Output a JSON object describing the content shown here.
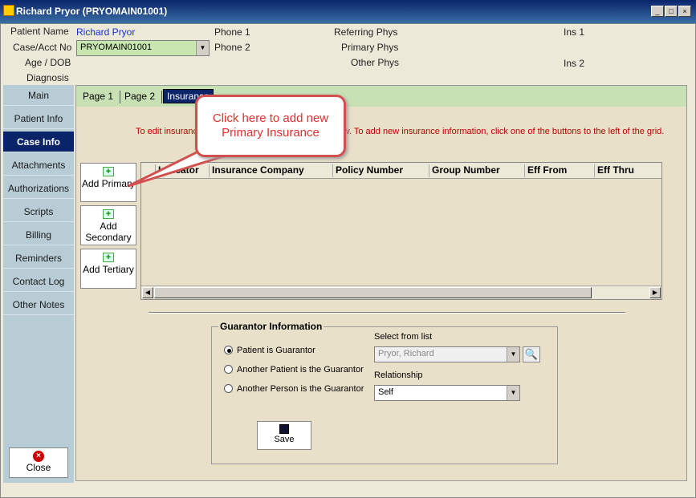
{
  "window": {
    "title": "Richard Pryor (PRYOMAIN01001)",
    "min": "_",
    "max": "□",
    "close": "×"
  },
  "header": {
    "patient_name_label": "Patient Name",
    "patient_name": "Richard Pryor",
    "case_label": "Case/Acct No",
    "case_value": "PRYOMAIN01001",
    "age_label": "Age / DOB",
    "diagnosis_label": "Diagnosis",
    "phone1_label": "Phone 1",
    "phone2_label": "Phone 2",
    "referring_label": "Referring Phys",
    "primary_label": "Primary Phys",
    "other_label": "Other Phys",
    "ins1_label": "Ins 1",
    "ins2_label": "Ins 2"
  },
  "sidebar": {
    "items": [
      {
        "label": "Main"
      },
      {
        "label": "Patient Info"
      },
      {
        "label": "Case Info"
      },
      {
        "label": "Attachments"
      },
      {
        "label": "Authorizations"
      },
      {
        "label": "Scripts"
      },
      {
        "label": "Billing"
      },
      {
        "label": "Reminders"
      },
      {
        "label": "Contact Log"
      },
      {
        "label": "Other Notes"
      }
    ],
    "active": "Case Info",
    "close_label": "Close"
  },
  "tabs": [
    "Page 1",
    "Page 2",
    "Insurance"
  ],
  "info_text": "To edit insurance information, double-click a row below. To add new insurance information, click one of the buttons to the left of the grid.",
  "add_buttons": {
    "primary": "Add Primary",
    "secondary": "Add Secondary",
    "tertiary": "Add Tertiary"
  },
  "grid": {
    "columns": [
      "Indicator",
      "Insurance Company",
      "Policy Number",
      "Group Number",
      "Eff From",
      "Eff Thru"
    ]
  },
  "guarantor": {
    "title": "Guarantor Information",
    "options": [
      "Patient is Guarantor",
      "Another Patient is the Guarantor",
      "Another Person is the Guarantor"
    ],
    "select_label": "Select from list",
    "select_value": "Pryor, Richard",
    "relationship_label": "Relationship",
    "relationship_value": "Self",
    "save_label": "Save"
  },
  "callout": {
    "text": "Click here to add new Primary Insurance"
  }
}
